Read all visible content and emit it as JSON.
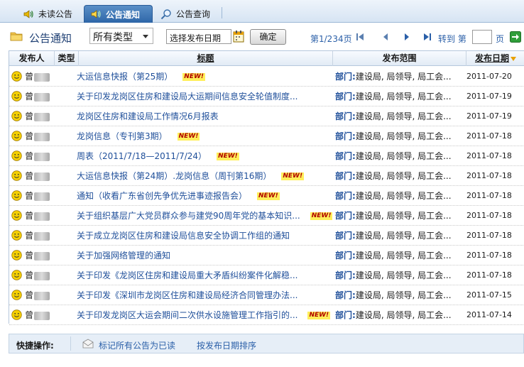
{
  "tabs": [
    {
      "label": "未读公告",
      "icon": "speaker-icon"
    },
    {
      "label": "公告通知",
      "icon": "speaker-icon",
      "active": true
    },
    {
      "label": "公告查询",
      "icon": "magnifier-icon"
    }
  ],
  "toolbar": {
    "title": "公告通知",
    "type_select_value": "所有类型",
    "date_placeholder": "选择发布日期",
    "confirm_label": "确定",
    "page_info": "第1/234页",
    "goto_label": "转到 第",
    "goto_value": "",
    "page_suffix": "页"
  },
  "table": {
    "columns": [
      "发布人",
      "类型",
      "标题",
      "发布范围",
      "发布日期"
    ],
    "scope_prefix": "部门:",
    "new_label": "NEW!",
    "rows": [
      {
        "user": "曾",
        "title": "大运信息快报（第25期）",
        "new": true,
        "scope": "建设局, 局领导, 局工会...",
        "date": "2011-07-20"
      },
      {
        "user": "曾",
        "title": "关于印发龙岗区住房和建设局大运期间信息安全轮值制度...",
        "new": false,
        "scope": "建设局, 局领导, 局工会...",
        "date": "2011-07-19"
      },
      {
        "user": "曾",
        "title": "龙岗区住房和建设局工作情况6月报表",
        "new": false,
        "scope": "建设局, 局领导, 局工会...",
        "date": "2011-07-19"
      },
      {
        "user": "曾",
        "title": "龙岗信息（专刊第3期）",
        "new": true,
        "scope": "建设局, 局领导, 局工会...",
        "date": "2011-07-18"
      },
      {
        "user": "曾",
        "title": "周表（2011/7/18—2011/7/24）",
        "new": true,
        "scope": "建设局, 局领导, 局工会...",
        "date": "2011-07-18"
      },
      {
        "user": "曾",
        "title": "大运信息快报（第24期）.龙岗信息（周刊第16期）",
        "new": true,
        "scope": "建设局, 局领导, 局工会...",
        "date": "2011-07-18"
      },
      {
        "user": "曾",
        "title": "通知（收看广东省创先争优先进事迹报告会）",
        "new": true,
        "scope": "建设局, 局领导, 局工会...",
        "date": "2011-07-18"
      },
      {
        "user": "曾",
        "title": "关于组织基层广大党员群众参与建党90周年党的基本知识...",
        "new": true,
        "scope": "建设局, 局领导, 局工会...",
        "date": "2011-07-18"
      },
      {
        "user": "曾",
        "title": "关于成立龙岗区住房和建设局信息安全协调工作组的通知",
        "new": false,
        "scope": "建设局, 局领导, 局工会...",
        "date": "2011-07-18"
      },
      {
        "user": "曾",
        "title": "关于加强网络管理的通知",
        "new": false,
        "scope": "建设局, 局领导, 局工会...",
        "date": "2011-07-18"
      },
      {
        "user": "曾",
        "title": "关于印发《龙岗区住房和建设局重大矛盾纠纷案件化解稳...",
        "new": false,
        "scope": "建设局, 局领导, 局工会...",
        "date": "2011-07-18"
      },
      {
        "user": "曾",
        "title": "关于印发《深圳市龙岗区住房和建设局经济合同管理办法...",
        "new": false,
        "scope": "建设局, 局领导, 局工会...",
        "date": "2011-07-15"
      },
      {
        "user": "曾",
        "title": "关于印发龙岗区大运会期间二次供水设施管理工作指引的...",
        "new": true,
        "scope": "建设局, 局领导, 局工会...",
        "date": "2011-07-14"
      }
    ]
  },
  "quick": {
    "label": "快捷操作:",
    "mark_all_read": "标记所有公告为已读",
    "sort_by_date": "按发布日期排序"
  },
  "colors": {
    "accent": "#2e66a8",
    "link": "#1f4f9a",
    "new_badge_bg": "#ffef5a",
    "face": "#f5d000"
  }
}
